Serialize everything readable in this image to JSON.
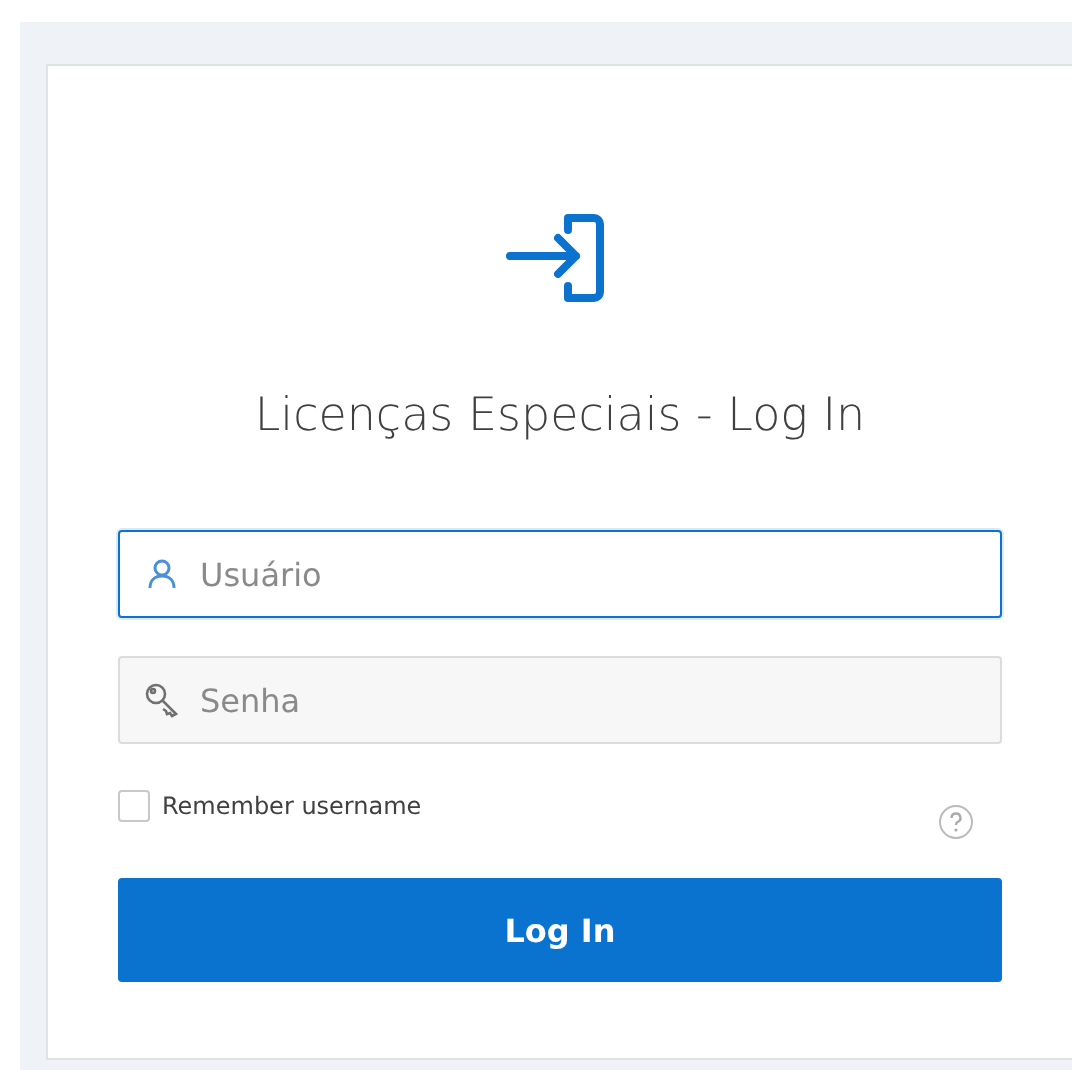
{
  "title": "Licenças Especiais - Log In",
  "fields": [
    {
      "kind": "user",
      "placeholder": "Usuário",
      "focused": true
    },
    {
      "kind": "password",
      "placeholder": "Senha",
      "focused": false
    }
  ],
  "remember": {
    "label": "Remember username",
    "checked": false
  },
  "submit": {
    "label": "Log In"
  }
}
